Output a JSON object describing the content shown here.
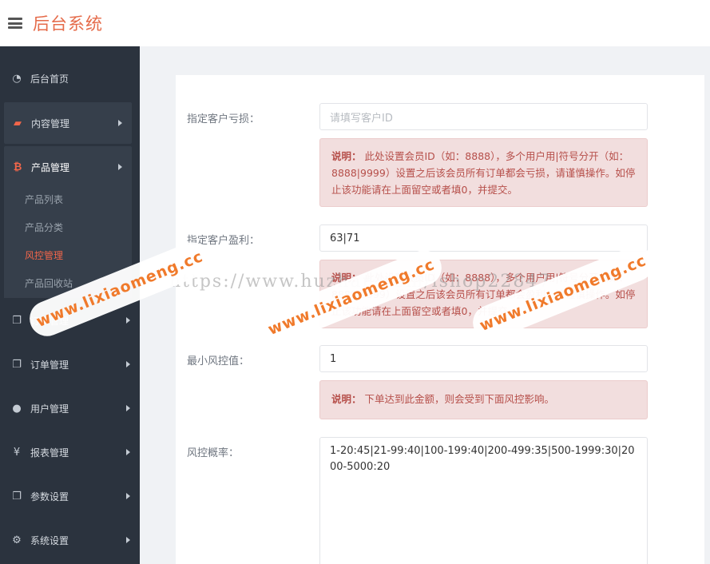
{
  "header": {
    "title": "后台系统"
  },
  "sidebar": {
    "items": [
      {
        "label": "后台首页",
        "icon": "dashboard-icon"
      },
      {
        "label": "内容管理",
        "icon": "book-icon"
      },
      {
        "label": "产品管理",
        "icon": "bitcoin-icon"
      },
      {
        "label": "订单管理",
        "icon": "copy-icon"
      },
      {
        "label": "订单管理",
        "icon": "copy-icon"
      },
      {
        "label": "用户管理",
        "icon": "user-icon"
      },
      {
        "label": "报表管理",
        "icon": "yen-icon"
      },
      {
        "label": "参数设置",
        "icon": "copy-icon"
      },
      {
        "label": "系统设置",
        "icon": "gears-icon"
      }
    ],
    "sub_items": [
      {
        "label": "产品列表"
      },
      {
        "label": "产品分类"
      },
      {
        "label": "风控管理"
      },
      {
        "label": "产品回收站"
      }
    ]
  },
  "form": {
    "loss_label": "指定客户亏损：",
    "loss_placeholder": "请填写客户ID",
    "loss_note_title": "说明：",
    "loss_note_text": "此处设置会员ID（如：8888），多个用户用|符号分开（如：8888|9999）设置之后该会员所有订单都会亏损，请谨慎操作。如停止该功能请在上面留空或者填0，并提交。",
    "profit_label": "指定客户盈利：",
    "profit_value": "63|71",
    "profit_note_title": "说明：",
    "profit_note_text": "此处设置会员ID（如：8888），多个用户用|符号分开（如：8888|9999）设置之后该会员所有订单都会盈利，请谨慎操作。如停止该功能请在上面留空或者填0，并提交。",
    "min_label": "最小风控值：",
    "min_value": "1",
    "min_note_title": "说明：",
    "min_note_text": "下单达到此金额，则会受到下面风控影响。",
    "prob_label": "风控概率：",
    "prob_value": "1-20:45|21-99:40|100-199:40|200-499:35|500-1999:30|2000-5000:20"
  },
  "watermark": {
    "url": "https://www.huzhan.com/ishop22847",
    "brand": "www.lixiaomeng.cc"
  },
  "colors": {
    "accent": "#e56b4a",
    "sidebar_bg": "#2b333e",
    "alert_bg": "#f2dede",
    "alert_text": "#b64f4a",
    "watermark": "#f07a2b"
  }
}
